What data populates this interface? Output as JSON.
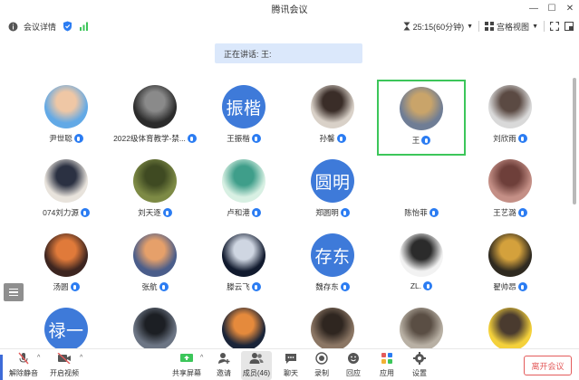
{
  "window": {
    "title": "腾讯会议"
  },
  "toolbar": {
    "meeting_details": "会议详情",
    "timer": "25:15(60分钟)",
    "view_mode": "宫格视图"
  },
  "speaking": "正在讲话: 王:",
  "participants": [
    {
      "name": "尹世聪",
      "avatar": "photo",
      "colors": [
        "#62a9e6",
        "#efc7a5"
      ]
    },
    {
      "name": "2022级体育教学-禁...",
      "avatar": "photo",
      "colors": [
        "#2b2b2b",
        "#8a8a8a"
      ]
    },
    {
      "name": "王振楷",
      "avatar": "text",
      "avatar_text": "振楷",
      "colors": [
        "#3e7ad9",
        "#3e7ad9"
      ]
    },
    {
      "name": "孙馨",
      "avatar": "photo",
      "colors": [
        "#d9d1c8",
        "#3a2d28"
      ]
    },
    {
      "name": "王",
      "avatar": "photo",
      "colors": [
        "#6f7d95",
        "#c9a46a"
      ],
      "active": true
    },
    {
      "name": "刘欣雨",
      "avatar": "photo",
      "colors": [
        "#d9d9d9",
        "#5b4a43"
      ]
    },
    {
      "name": "074刘力源",
      "avatar": "photo",
      "colors": [
        "#e8e3dc",
        "#2b3142"
      ]
    },
    {
      "name": "刘天逐",
      "avatar": "photo",
      "colors": [
        "#7d8a45",
        "#3f4a22"
      ]
    },
    {
      "name": "卢和港",
      "avatar": "photo",
      "colors": [
        "#d8f0e3",
        "#3f9e8a"
      ]
    },
    {
      "name": "郑圆明",
      "avatar": "text",
      "avatar_text": "圆明",
      "colors": [
        "#3e7ad9",
        "#3e7ad9"
      ]
    },
    {
      "name": "陈怡菲",
      "avatar": "none",
      "colors": [
        "#ffffff",
        "#ffffff"
      ]
    },
    {
      "name": "王艺潞",
      "avatar": "photo",
      "colors": [
        "#c48f86",
        "#6e3f3a"
      ]
    },
    {
      "name": "汤圆",
      "avatar": "photo",
      "colors": [
        "#3d2520",
        "#e07a3a"
      ]
    },
    {
      "name": "张航",
      "avatar": "photo",
      "colors": [
        "#4a5d8a",
        "#e6a06a"
      ]
    },
    {
      "name": "滕云飞",
      "avatar": "photo",
      "colors": [
        "#111a2e",
        "#cfd6e2"
      ]
    },
    {
      "name": "魏存东",
      "avatar": "text",
      "avatar_text": "存东",
      "colors": [
        "#3e7ad9",
        "#3e7ad9"
      ]
    },
    {
      "name": "ZL.",
      "avatar": "photo",
      "colors": [
        "#f2f2f2",
        "#2b2b2b"
      ]
    },
    {
      "name": "翟帅昂",
      "avatar": "photo",
      "colors": [
        "#2f2a20",
        "#d4a13c"
      ]
    },
    {
      "name": "",
      "avatar": "text",
      "avatar_text": "禄一",
      "colors": [
        "#3e7ad9",
        "#3e7ad9"
      ]
    },
    {
      "name": "",
      "avatar": "photo",
      "colors": [
        "#6c7584",
        "#1c1f24"
      ]
    },
    {
      "name": "",
      "avatar": "photo",
      "colors": [
        "#1a2438",
        "#e58a3c"
      ]
    },
    {
      "name": "",
      "avatar": "photo",
      "colors": [
        "#8b7664",
        "#2f2620"
      ]
    },
    {
      "name": "",
      "avatar": "photo",
      "colors": [
        "#b8b0a4",
        "#5a4e44"
      ]
    },
    {
      "name": "",
      "avatar": "photo",
      "colors": [
        "#f4d13b",
        "#4a3b2f"
      ]
    }
  ],
  "bottombar": {
    "unmute": "解除静音",
    "start_video": "开启视频",
    "share_screen": "共享屏幕",
    "invite": "邀请",
    "members": "成员(46)",
    "chat": "聊天",
    "record": "录制",
    "reactions": "回应",
    "apps": "应用",
    "settings": "设置",
    "leave": "离开会议"
  },
  "colors": {
    "accent": "#2b7cf2",
    "active_border": "#3cc65a",
    "leave": "#e35b5b",
    "speaking_bg": "#dbe8fb"
  }
}
